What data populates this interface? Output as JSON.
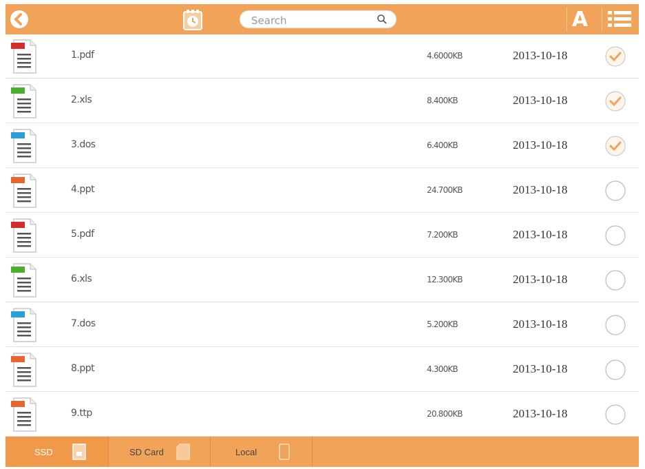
{
  "toolbar": {
    "search_placeholder": "Search",
    "font_label": "A"
  },
  "colors": {
    "accent": "#f2a35a",
    "check": "#f2a35a",
    "pdf": "#d62b2b",
    "xls": "#4caf2f",
    "doc": "#2a9fd8",
    "ppt": "#e8662d"
  },
  "files": [
    {
      "name": "1.pdf",
      "size": "4.6000KB",
      "date": "2013-10-18",
      "type": "PDF",
      "checked": true
    },
    {
      "name": "2.xls",
      "size": "8.400KB",
      "date": "2013-10-18",
      "type": "XLS",
      "checked": true
    },
    {
      "name": "3.dos",
      "size": "6.400KB",
      "date": "2013-10-18",
      "type": "DOC",
      "checked": true
    },
    {
      "name": "4.ppt",
      "size": "24.700KB",
      "date": "2013-10-18",
      "type": "PPT",
      "checked": false
    },
    {
      "name": "5.pdf",
      "size": "7.200KB",
      "date": "2013-10-18",
      "type": "PDF",
      "checked": false
    },
    {
      "name": "6.xls",
      "size": "12.300KB",
      "date": "2013-10-18",
      "type": "XLS",
      "checked": false
    },
    {
      "name": "7.dos",
      "size": "5.200KB",
      "date": "2013-10-18",
      "type": "DOC",
      "checked": false
    },
    {
      "name": "8.ppt",
      "size": "4.300KB",
      "date": "2013-10-18",
      "type": "PPT",
      "checked": false
    },
    {
      "name": "9.ttp",
      "size": "20.800KB",
      "date": "2013-10-18",
      "type": "PPT",
      "checked": false
    }
  ],
  "bottom_tabs": [
    {
      "label": "SSD",
      "active": true
    },
    {
      "label": "SD Card",
      "active": false
    },
    {
      "label": "Local",
      "active": false
    }
  ]
}
